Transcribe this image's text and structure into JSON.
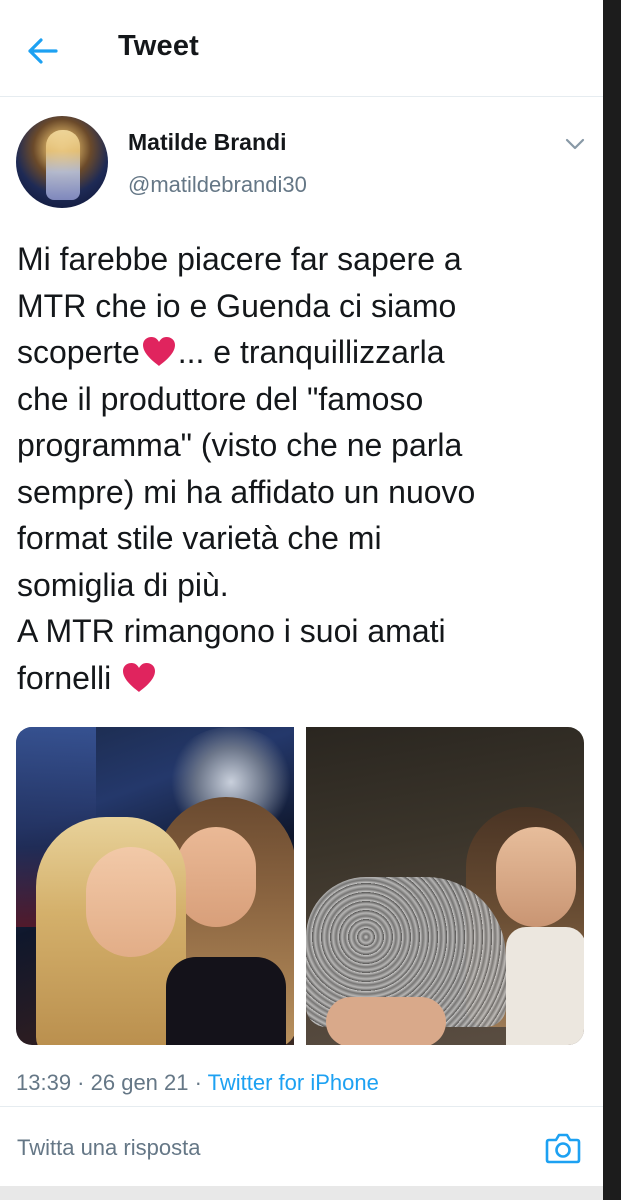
{
  "header": {
    "title": "Tweet",
    "back_icon": "arrow-left-icon"
  },
  "author": {
    "name": "Matilde Brandi",
    "handle": "@matildebrandi30",
    "menu_icon": "chevron-down-icon"
  },
  "tweet": {
    "lines": [
      "Mi farebbe piacere far sapere a",
      "MTR che io e Guenda ci siamo",
      "scoperte",
      "... e tranquillizzarla",
      "che il produttore del \"famoso",
      "programma\" (visto che ne parla",
      "sempre) mi ha affidato un nuovo",
      "format stile varietà che mi",
      "somiglia di più.",
      "A MTR rimangono i suoi amati",
      "fornelli "
    ],
    "emoji": "heart-emoji"
  },
  "meta": {
    "time": "13:39",
    "sep1": " · ",
    "date": "26 gen 21",
    "sep2": " · ",
    "source": "Twitter for iPhone"
  },
  "reply": {
    "placeholder": "Twitta una risposta",
    "camera_icon": "camera-icon"
  },
  "colors": {
    "accent": "#1da1f2",
    "text": "#14171a",
    "secondary": "#657786",
    "heart": "#e0245e"
  }
}
